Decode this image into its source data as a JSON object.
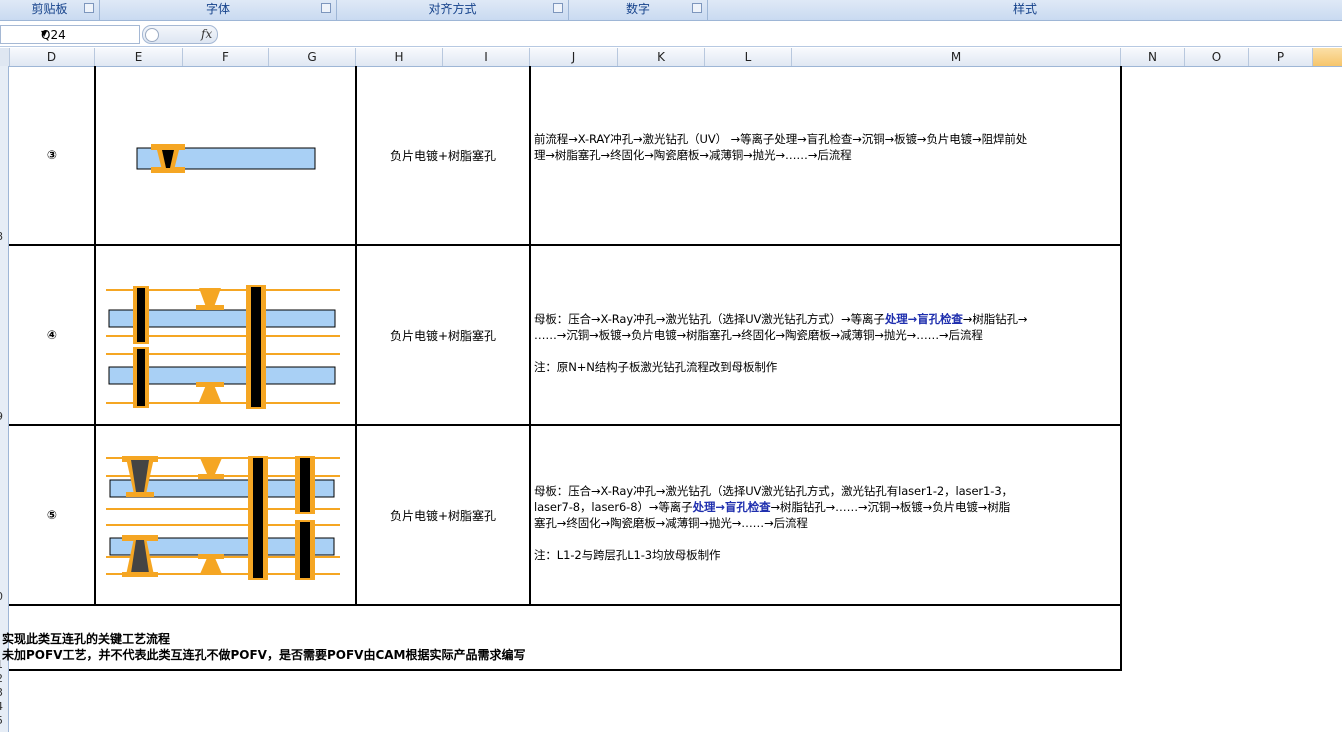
{
  "ribbon": {
    "groups": [
      "剪贴板",
      "字体",
      "对齐方式",
      "数字",
      "样式"
    ]
  },
  "formula_bar": {
    "name_box": "Q24",
    "fx_label": "fx",
    "formula": ""
  },
  "columns": [
    "D",
    "E",
    "F",
    "G",
    "H",
    "I",
    "J",
    "K",
    "L",
    "M",
    "N",
    "O",
    "P"
  ],
  "row_numbers": [
    "8",
    "9",
    "0",
    "1",
    "2",
    "3",
    "4",
    "5"
  ],
  "rows": [
    {
      "index": "③",
      "process": "负片电镀+树脂塞孔",
      "flow_lines": [
        "前流程→X-RAY冲孔→激光钻孔（UV） →等离子处理→盲孔检查→沉铜→板镀→负片电镀→阻焊前处",
        "理→树脂塞孔→终固化→陶瓷磨板→减薄铜→抛光→……→后流程"
      ]
    },
    {
      "index": "④",
      "process": "负片电镀+树脂塞孔",
      "flow_line1_pre": "母板：压合→X-Ray冲孔→激光钻孔（选择UV激光钻孔方式）→等离子",
      "flow_line1_hl": "处理→盲孔检查",
      "flow_line1_post": "→树脂钻孔→",
      "flow_line2": "……→沉铜→板镀→负片电镀→树脂塞孔→终固化→陶瓷磨板→减薄铜→抛光→……→后流程",
      "note": "注：原N+N结构子板激光钻孔流程改到母板制作"
    },
    {
      "index": "⑤",
      "process": "负片电镀+树脂塞孔",
      "flow_line1": "母板：压合→X-Ray冲孔→激光钻孔（选择UV激光钻孔方式，激光钻孔有laser1-2，laser1-3，",
      "flow_line2_pre": "laser7-8，laser6-8）→等离子",
      "flow_line2_hl": "处理→盲孔检查",
      "flow_line2_post": "→树脂钻孔→……→沉铜→板镀→负片电镀→树脂",
      "flow_line3": "塞孔→终固化→陶瓷磨板→减薄铜→抛光→……→后流程",
      "note": "注：L1-2与跨层孔L1-3均放母板制作"
    }
  ],
  "footer_notes": [
    "实现此类互连孔的关键工艺流程",
    "未加POFV工艺，并不代表此类互连孔不做POFV，是否需要POFV由CAM根据实际产品需求编写"
  ],
  "colors": {
    "copper": "#f5a623",
    "core": "#a9d0f5",
    "via": "#000000",
    "header_bg": "#dfe9f6",
    "highlight_text": "#1f2fae"
  }
}
